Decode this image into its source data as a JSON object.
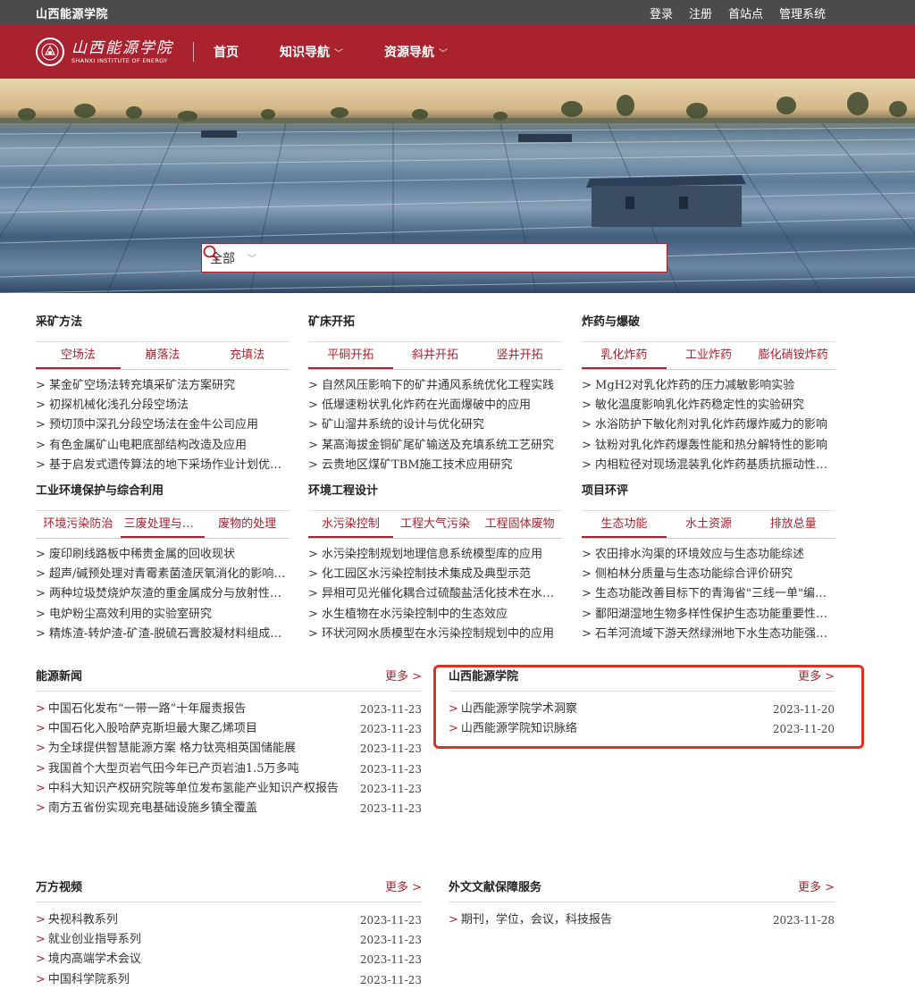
{
  "topbar": {
    "site_name": "山西能源学院",
    "links": [
      "登录",
      "注册",
      "首站点",
      "管理系统"
    ]
  },
  "nav": {
    "logo_cn": "山西能源学院",
    "logo_en": "SHANXI INSTITUTE OF ENERGY",
    "items": [
      "首页",
      "知识导航",
      "资源导航"
    ]
  },
  "search": {
    "scope": "全部",
    "placeholder": ""
  },
  "categories": [
    {
      "title": "采矿方法",
      "tabs": [
        "空场法",
        "崩落法",
        "充填法"
      ],
      "active_tab": 0,
      "items": [
        "> 某金矿空场法转充填采矿法方案研究",
        "> 初探机械化浅孔分段空场法",
        "> 预切顶中深孔分段空场法在金牛公司应用",
        "> 有色金属矿山电耙底部结构改造及应用",
        "> 基于启发式遗传算法的地下采场作业计划优化研究"
      ]
    },
    {
      "title": "矿床开拓",
      "tabs": [
        "平硐开拓",
        "斜井开拓",
        "竖井开拓"
      ],
      "active_tab": 0,
      "items": [
        "> 自然风压影响下的矿井通风系统优化工程实践",
        "> 低爆速粉状乳化炸药在光面爆破中的应用",
        "> 矿山溜井系统的设计与优化研究",
        "> 某高海拔金铜矿尾矿输送及充填系统工艺研究",
        "> 云贵地区煤矿TBM施工技术应用研究"
      ]
    },
    {
      "title": "炸药与爆破",
      "tabs": [
        "乳化炸药",
        "工业炸药",
        "膨化硝铵炸药"
      ],
      "active_tab": 0,
      "items": [
        "> MgH2对乳化炸药的压力减敏影响实验",
        "> 敏化温度影响乳化炸药稳定性的实验研究",
        "> 水浴防护下敏化剂对乳化炸药爆炸威力的影响",
        "> 钛粉对乳化炸药爆轰性能和热分解特性的影响",
        "> 内相粒径对现场混装乳化炸药基质抗振动性能的影响"
      ]
    },
    {
      "title": "工业环境保护与综合利用",
      "tabs": [
        "环境污染防治",
        "三废处理与利用",
        "废物的处理"
      ],
      "active_tab": 1,
      "items": [
        "> 废印刷线路板中稀贵金属的回收现状",
        "> 超声/碱预处理对青霉素菌渣厌氧消化的影响研究",
        "> 两种垃圾焚烧炉灰渣的重金属成分与放射性研究",
        "> 电炉粉尘高效利用的实验室研究",
        "> 精炼渣-转炉渣-矿渣-脱硫石膏胶凝材料组成设计研究"
      ]
    },
    {
      "title": "环境工程设计",
      "tabs": [
        "水污染控制",
        "工程大气污染",
        "工程固体废物"
      ],
      "active_tab": 0,
      "items": [
        "> 水污染控制规划地理信息系统模型库的应用",
        "> 化工园区水污染控制技术集成及典型示范",
        "> 异相可见光催化耦合过硫酸盐活化技术在水处理中的应用",
        "> 水生植物在水污染控制中的生态效应",
        "> 环状河网水质模型在水污染控制规划中的应用"
      ]
    },
    {
      "title": "项目环评",
      "tabs": [
        "生态功能",
        "水土资源",
        "排放总量"
      ],
      "active_tab": 0,
      "items": [
        "> 农田排水沟渠的环境效应与生态功能综述",
        "> 侧柏林分质量与生态功能综合评价研究",
        "> 生态功能改善目标下的青海省\"三线一单\"编制研究",
        "> 鄱阳湖湿地生物多样性保护生态功能重要性评价",
        "> 石羊河流域下游天然绿洲地下水生态功能强弱研究"
      ]
    }
  ],
  "panels": {
    "energy_news": {
      "title": "能源新闻",
      "more": "更多 >",
      "rows": [
        {
          "title": "中国石化发布“一带一路”十年履责报告",
          "date": "2023-11-23"
        },
        {
          "title": "中国石化入股哈萨克斯坦最大聚乙烯项目",
          "date": "2023-11-23"
        },
        {
          "title": "为全球提供智慧能源方案 格力钛亮相英国储能展",
          "date": "2023-11-23"
        },
        {
          "title": "我国首个大型页岩气田今年已产页岩油1.5万多吨",
          "date": "2023-11-23"
        },
        {
          "title": "中科大知识产权研究院等单位发布氢能产业知识产权报告",
          "date": "2023-11-23"
        },
        {
          "title": "南方五省份实现充电基础设施乡镇全覆盖",
          "date": "2023-11-23"
        }
      ]
    },
    "institute": {
      "title": "山西能源学院",
      "more": "更多 >",
      "rows": [
        {
          "title": "山西能源学院学术洞察",
          "date": "2023-11-20"
        },
        {
          "title": "山西能源学院知识脉络",
          "date": "2023-11-20"
        }
      ]
    },
    "video": {
      "title": "万方视频",
      "more": "更多 >",
      "rows": [
        {
          "title": "央视科教系列",
          "date": "2023-11-23"
        },
        {
          "title": "就业创业指导系列",
          "date": "2023-11-23"
        },
        {
          "title": "境内高端学术会议",
          "date": "2023-11-23"
        },
        {
          "title": "中国科学院系列",
          "date": "2023-11-23"
        }
      ]
    },
    "foreign_docs": {
      "title": "外文文献保障服务",
      "more": "更多 >",
      "rows": [
        {
          "title": "期刊，学位，会议，科技报告",
          "date": "2023-11-28"
        }
      ]
    }
  },
  "colors": {
    "brand": "#a8232f",
    "topbar": "#4b4b4b",
    "highlight": "#e0301e"
  }
}
